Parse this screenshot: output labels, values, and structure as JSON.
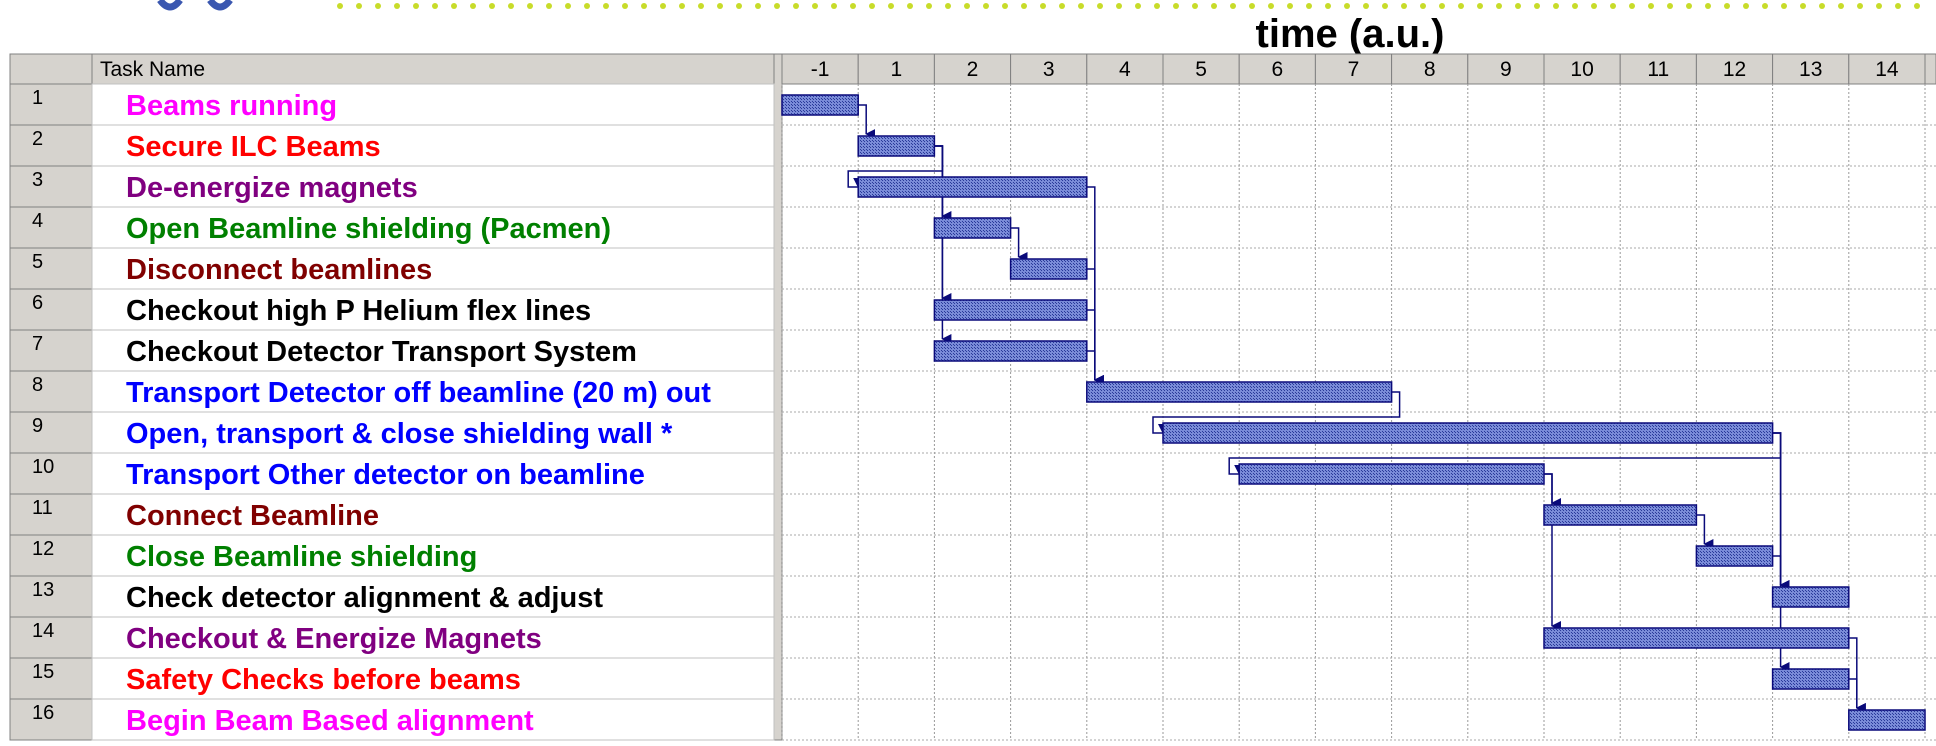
{
  "header": {
    "axis_title": "time (a.u.)",
    "task_name_label": "Task Name"
  },
  "timescale": [
    "-1",
    "1",
    "2",
    "3",
    "4",
    "5",
    "6",
    "7",
    "8",
    "9",
    "10",
    "11",
    "12",
    "13",
    "14"
  ],
  "colors": {
    "bar_fill": "#5b6fc4",
    "bar_stroke": "#0a0a7a",
    "link": "#0a0a7a",
    "header_bg": "#d6d3ce",
    "grid": "#bbbbbb",
    "deco_dot": "#c8dc2a"
  },
  "chart_data": {
    "type": "gantt",
    "time_unit": "a.u.",
    "tasks": [
      {
        "id": "1",
        "name": "Beams running",
        "color": "#ff00ff",
        "start": -1,
        "end": 0
      },
      {
        "id": "2",
        "name": "Secure ILC Beams",
        "color": "#ff0000",
        "start": 0,
        "end": 1
      },
      {
        "id": "3",
        "name": "De-energize magnets",
        "color": "#800080",
        "start": 0,
        "end": 3
      },
      {
        "id": "4",
        "name": "Open Beamline shielding (Pacmen)",
        "color": "#008000",
        "start": 1,
        "end": 2
      },
      {
        "id": "5",
        "name": "Disconnect beamlines",
        "color": "#800000",
        "start": 2,
        "end": 3
      },
      {
        "id": "6",
        "name": "Checkout high P Helium flex lines",
        "color": "#000000",
        "start": 1,
        "end": 3
      },
      {
        "id": "7",
        "name": "Checkout Detector Transport System",
        "color": "#000000",
        "start": 1,
        "end": 3
      },
      {
        "id": "8",
        "name": "Transport Detector off beamline  (20 m) out",
        "color": "#0000ff",
        "start": 3,
        "end": 7
      },
      {
        "id": "9",
        "name": "Open, transport & close shielding wall *",
        "color": "#0000ff",
        "start": 4,
        "end": 12
      },
      {
        "id": "10",
        "name": "Transport Other detector on beamline",
        "color": "#0000ff",
        "start": 5,
        "end": 9
      },
      {
        "id": "11",
        "name": "Connect Beamline",
        "color": "#800000",
        "start": 9,
        "end": 11
      },
      {
        "id": "12",
        "name": "Close Beamline shielding",
        "color": "#008000",
        "start": 11,
        "end": 12
      },
      {
        "id": "13",
        "name": "Check detector alignment & adjust",
        "color": "#000000",
        "start": 12,
        "end": 13
      },
      {
        "id": "14",
        "name": "Checkout & Energize Magnets",
        "color": "#800080",
        "start": 9,
        "end": 13
      },
      {
        "id": "15",
        "name": "Safety Checks before beams",
        "color": "#ff0000",
        "start": 12,
        "end": 13
      },
      {
        "id": "16",
        "name": "Begin Beam Based alignment",
        "color": "#ff00ff",
        "start": 13,
        "end": 14
      }
    ],
    "dependencies": [
      [
        "1",
        "2"
      ],
      [
        "2",
        "3"
      ],
      [
        "2",
        "4"
      ],
      [
        "2",
        "6"
      ],
      [
        "2",
        "7"
      ],
      [
        "4",
        "5"
      ],
      [
        "3",
        "8"
      ],
      [
        "5",
        "8"
      ],
      [
        "6",
        "8"
      ],
      [
        "7",
        "8"
      ],
      [
        "8",
        "9"
      ],
      [
        "9",
        "10"
      ],
      [
        "10",
        "11"
      ],
      [
        "10",
        "14"
      ],
      [
        "11",
        "12"
      ],
      [
        "9",
        "13"
      ],
      [
        "12",
        "13"
      ],
      [
        "9",
        "15"
      ],
      [
        "15",
        "16"
      ],
      [
        "14",
        "16"
      ]
    ]
  }
}
